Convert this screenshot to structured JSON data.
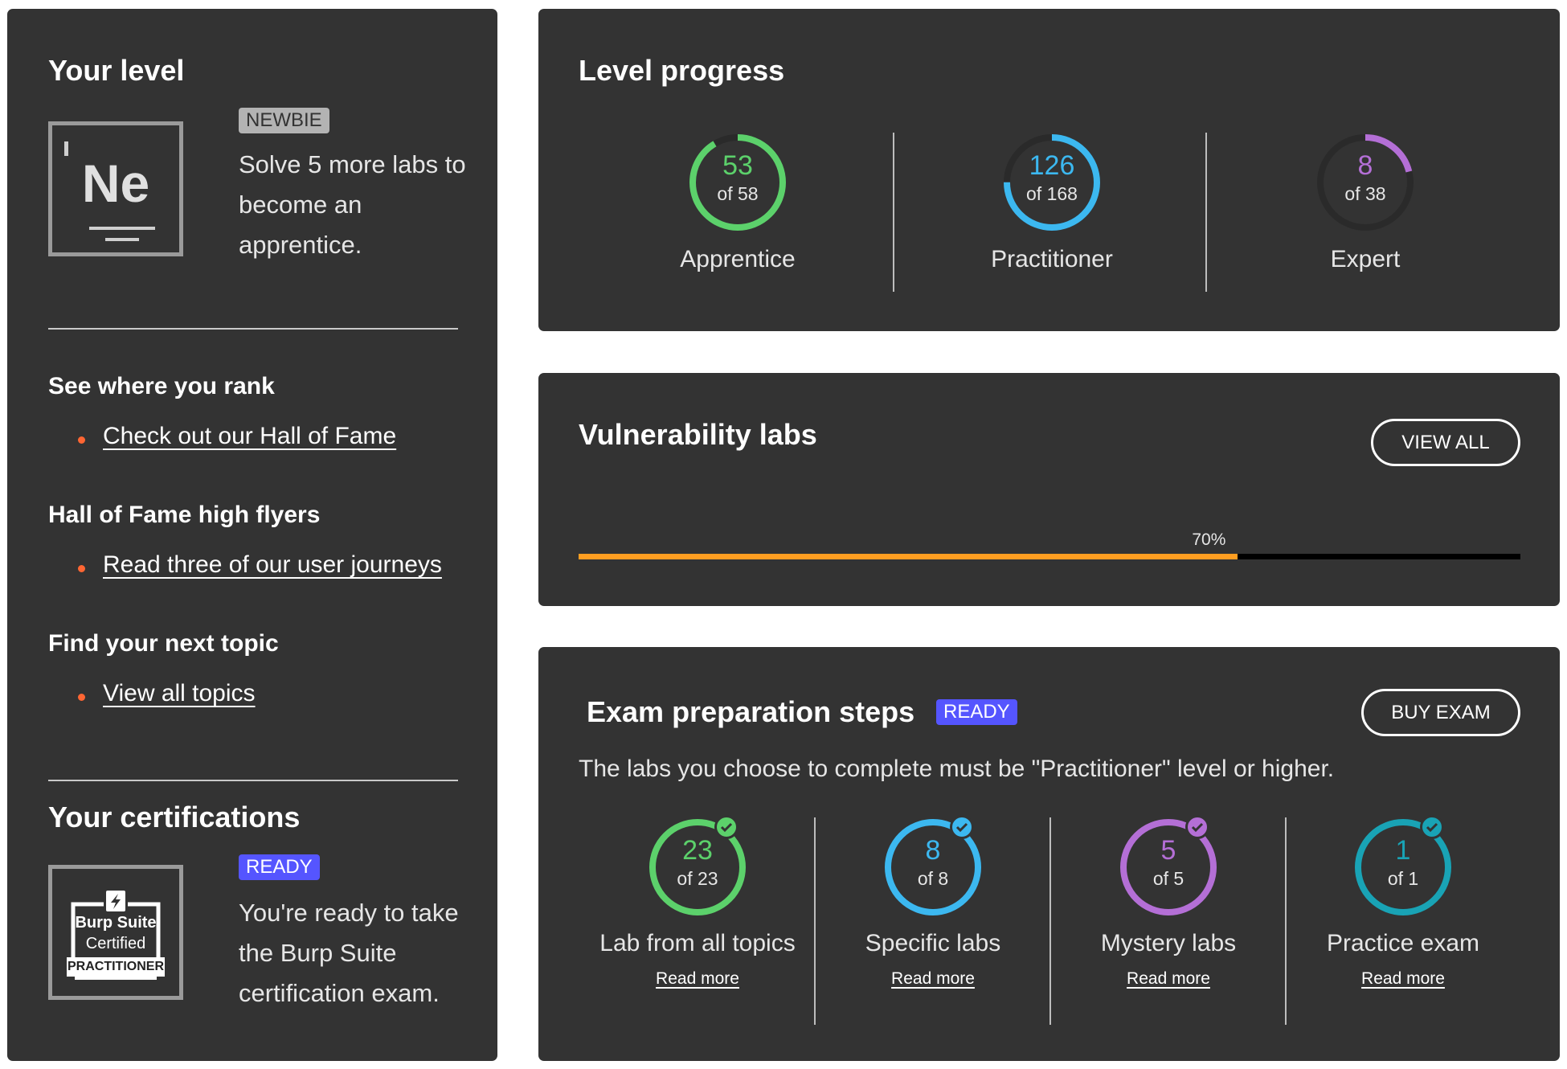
{
  "your_level": {
    "title": "Your level",
    "element_symbol": "Ne",
    "badge": "NEWBIE",
    "description": "Solve 5 more labs to become an apprentice."
  },
  "rank": {
    "title": "See where you rank",
    "link": "Check out our Hall of Fame"
  },
  "high_flyers": {
    "title": "Hall of Fame high flyers",
    "link": "Read three of our user journeys"
  },
  "next_topic": {
    "title": "Find your next topic",
    "link": "View all topics"
  },
  "certifications": {
    "title": "Your certifications",
    "badge": "READY",
    "description": "You're ready to take the Burp Suite certification exam.",
    "cert_line1": "Burp Suite",
    "cert_line2": "Certified",
    "cert_line3": "PRACTITIONER"
  },
  "level_progress": {
    "title": "Level progress",
    "levels": [
      {
        "value": "53",
        "of": "of 58",
        "label": "Apprentice",
        "fraction": 0.914,
        "color": "#5cd16b"
      },
      {
        "value": "126",
        "of": "of 168",
        "label": "Practitioner",
        "fraction": 0.75,
        "color": "#3cb8f0"
      },
      {
        "value": "8",
        "of": "of 38",
        "label": "Expert",
        "fraction": 0.211,
        "color": "#b46fd6"
      }
    ]
  },
  "vulnerability_labs": {
    "title": "Vulnerability labs",
    "button": "VIEW ALL",
    "progress_label": "70%",
    "progress": 0.7,
    "fill_color": "#ff9e21"
  },
  "exam": {
    "title": "Exam preparation steps",
    "badge": "READY",
    "button": "BUY EXAM",
    "description": "The labs you choose to complete must be \"Practitioner\" level or higher.",
    "read_more": "Read more",
    "steps": [
      {
        "value": "23",
        "of": "of 23",
        "label": "Lab from all topics",
        "fraction": 1,
        "color": "#5cd16b"
      },
      {
        "value": "8",
        "of": "of 8",
        "label": "Specific labs",
        "fraction": 1,
        "color": "#3cb8f0"
      },
      {
        "value": "5",
        "of": "of 5",
        "label": "Mystery labs",
        "fraction": 1,
        "color": "#b46fd6"
      },
      {
        "value": "1",
        "of": "of 1",
        "label": "Practice exam",
        "fraction": 1,
        "color": "#19a3b5"
      }
    ]
  }
}
